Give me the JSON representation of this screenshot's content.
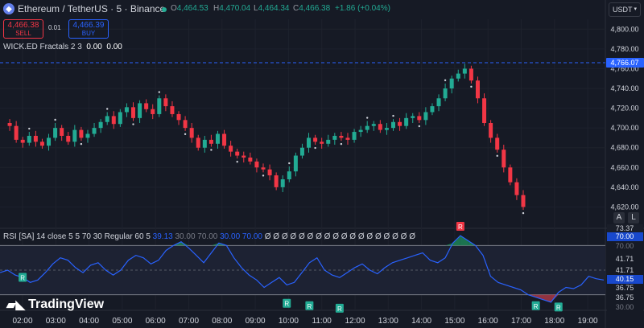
{
  "header": {
    "symbol": "Ethereum / TetherUS · 5 · Binance",
    "ohlc": [
      {
        "k": "O",
        "v": "4,464.53"
      },
      {
        "k": "H",
        "v": "4,470.04"
      },
      {
        "k": "L",
        "v": "4,464.34"
      },
      {
        "k": "C",
        "v": "4,466.38"
      }
    ],
    "change": "+1.86 (+0.04%)"
  },
  "trade": {
    "sell_price": "4,466.38",
    "sell_label": "SELL",
    "spread": "0.01",
    "buy_price": "4,466.39",
    "buy_label": "BUY"
  },
  "indicator": {
    "fractals": "WICK.ED Fractals 2 3",
    "fractal_v1": "0.00",
    "fractal_v2": "0.00"
  },
  "currency_selector": "USDT",
  "scale_buttons": {
    "auto": "A",
    "log": "L"
  },
  "rsi_legend": {
    "name": "RSI [SA] 14 close 5 5 70 30 Regular 60 5",
    "values": [
      "39.13",
      "30.00",
      "70.00",
      "30.00",
      "70.00"
    ],
    "zeros": "Ø Ø Ø Ø Ø Ø Ø Ø Ø Ø Ø Ø Ø Ø Ø Ø Ø Ø"
  },
  "brand": "TradingView",
  "price_axis": [
    "4,800.00",
    "4,780.00",
    "4,760.00",
    "4,740.00",
    "4,720.00",
    "4,700.00",
    "4,680.00",
    "4,660.00",
    "4,640.00",
    "4,620.00"
  ],
  "price_highlight": "4,766.07",
  "rsi_axis_labels": [
    {
      "text": "73.37",
      "color": "#1a1e29",
      "fg": "#d1d4dc"
    },
    {
      "text": "70.00",
      "color": "#1848cc",
      "fg": "#ffffff"
    },
    {
      "text": "70.00",
      "color": "#161a25",
      "fg": "#787b86"
    },
    {
      "text": "41.71",
      "color": "#161a25",
      "fg": "#d1d4dc"
    },
    {
      "text": "41.71",
      "color": "#161a25",
      "fg": "#d1d4dc"
    },
    {
      "text": "40.15",
      "color": "#1848cc",
      "fg": "#ffffff"
    },
    {
      "text": "36.75",
      "color": "#161a25",
      "fg": "#d1d4dc"
    },
    {
      "text": "36.75",
      "color": "#161a25",
      "fg": "#d1d4dc"
    },
    {
      "text": "30.00",
      "color": "#161a25",
      "fg": "#787b86"
    }
  ],
  "time_axis": [
    "02:00",
    "03:00",
    "04:00",
    "05:00",
    "06:00",
    "07:00",
    "08:00",
    "09:00",
    "10:00",
    "11:00",
    "12:00",
    "13:00",
    "14:00",
    "15:00",
    "16:00",
    "17:00",
    "18:00",
    "19:00"
  ],
  "signal_labels": [
    "R",
    "R",
    "R",
    "R",
    "R",
    "R",
    "R"
  ],
  "colors": {
    "up": "#22ab94",
    "down": "#f23645",
    "rsi": "#2962ff",
    "bg": "#161a25"
  },
  "chart_data": {
    "type": "line",
    "price_path": [
      4705,
      4702,
      4688,
      4685,
      4692,
      4686,
      4682,
      4690,
      4700,
      4692,
      4686,
      4698,
      4690,
      4694,
      4700,
      4706,
      4712,
      4704,
      4716,
      4721,
      4710,
      4725,
      4719,
      4714,
      4730,
      4722,
      4714,
      4708,
      4700,
      4690,
      4680,
      4688,
      4684,
      4694,
      4682,
      4676,
      4672,
      4670,
      4666,
      4660,
      4658,
      4652,
      4640,
      4648,
      4656,
      4672,
      4680,
      4690,
      4686,
      4684,
      4688,
      4692,
      4690,
      4688,
      4696,
      4698,
      4702,
      4704,
      4698,
      4700,
      4706,
      4702,
      4710,
      4712,
      4708,
      4716,
      4722,
      4730,
      4740,
      4750,
      4755,
      4760,
      4748,
      4730,
      4705,
      4690,
      4678,
      4660,
      4645,
      4632,
      4620
    ],
    "price_range": [
      4600,
      4810
    ],
    "rsi_path": [
      48,
      50,
      46,
      44,
      40,
      42,
      48,
      55,
      60,
      58,
      52,
      48,
      54,
      56,
      50,
      46,
      50,
      58,
      62,
      60,
      55,
      58,
      66,
      70,
      73,
      68,
      62,
      56,
      64,
      72,
      70,
      60,
      52,
      46,
      42,
      36,
      40,
      44,
      38,
      40,
      48,
      56,
      60,
      50,
      46,
      44,
      48,
      52,
      55,
      50,
      47,
      52,
      56,
      58,
      60,
      62,
      64,
      58,
      56,
      60,
      72,
      78,
      74,
      70,
      62,
      45,
      40,
      38,
      36,
      34,
      30,
      28,
      26,
      24,
      32,
      36,
      35,
      38,
      45,
      43,
      42
    ],
    "rsi_range": [
      20,
      80
    ],
    "rsi_levels": [
      70,
      30
    ]
  }
}
